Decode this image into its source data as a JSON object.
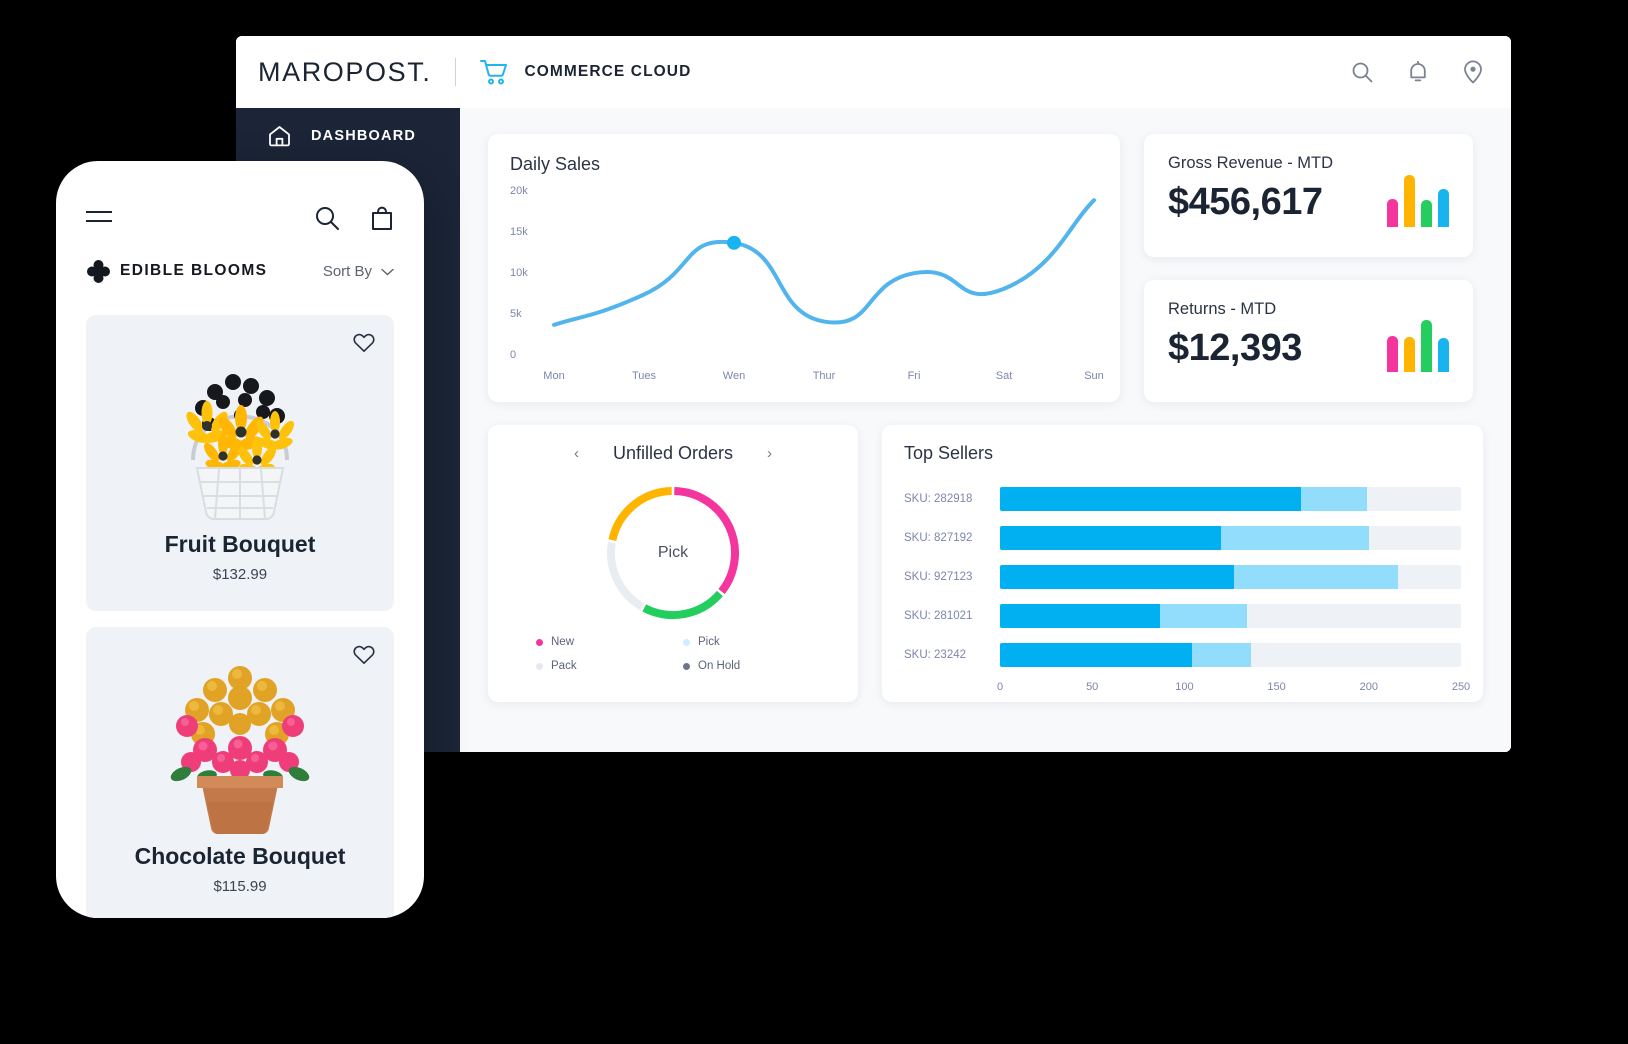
{
  "app": {
    "brand": "MAROPOST",
    "brand_suffix": ".",
    "product_line": "COMMERCE CLOUD",
    "topbar_icons": [
      "search-icon",
      "bell-icon",
      "location-pin-icon"
    ]
  },
  "sidebar": {
    "items": [
      {
        "label": "DASHBOARD",
        "icon": "home-icon",
        "active": true
      }
    ]
  },
  "daily_sales": {
    "title": "Daily Sales"
  },
  "kpis": [
    {
      "title": "Gross Revenue - MTD",
      "value": "$456,617",
      "spark": [
        {
          "color": "#f5359e",
          "height": 28
        },
        {
          "color": "#ffb400",
          "height": 52
        },
        {
          "color": "#23cd5e",
          "height": 27
        },
        {
          "color": "#18b4f0",
          "height": 38
        }
      ]
    },
    {
      "title": "Returns - MTD",
      "value": "$12,393",
      "spark": [
        {
          "color": "#f5359e",
          "height": 36
        },
        {
          "color": "#ffb400",
          "height": 35
        },
        {
          "color": "#23cd5e",
          "height": 52
        },
        {
          "color": "#18b4f0",
          "height": 34
        }
      ]
    }
  ],
  "unfilled_orders": {
    "title": "Unfilled Orders",
    "prev_arrow": "‹",
    "next_arrow": "›",
    "center_label": "Pick",
    "legend": [
      {
        "label": "New",
        "color": "#f5359e"
      },
      {
        "label": "Pick",
        "color": "#cfeefd"
      },
      {
        "label": "Pack",
        "color": "#e4e8ef"
      },
      {
        "label": "On Hold",
        "color": "#6d7588"
      }
    ]
  },
  "top_sellers": {
    "title": "Top Sellers"
  },
  "phone": {
    "menu_icon": "hamburger-icon",
    "search_icon": "search-icon",
    "bag_icon": "shopping-bag-icon",
    "brand": "EDIBLE BLOOMS",
    "brand_icon": "flower-logo-icon",
    "sort_label": "Sort By",
    "sort_chevron": "chevron-down-icon",
    "products": [
      {
        "name": "Fruit Bouquet",
        "price": "$132.99",
        "favourite_icon": "heart-icon",
        "art": "fruit-basket"
      },
      {
        "name": "Chocolate Bouquet",
        "price": "$115.99",
        "favourite_icon": "heart-icon",
        "art": "chocolate-pot"
      }
    ]
  },
  "chart_data": [
    {
      "type": "line",
      "title": "Daily Sales",
      "xlabel": "",
      "ylabel": "",
      "categories": [
        "Mon",
        "Tues",
        "Wen",
        "Thur",
        "Fri",
        "Sat",
        "Sun"
      ],
      "values": [
        3800,
        7500,
        13800,
        4200,
        10100,
        8200,
        19000
      ],
      "ylim": [
        0,
        20000
      ],
      "yticks": [
        "0",
        "5k",
        "10k",
        "15k",
        "20k"
      ],
      "ytick_values": [
        0,
        5000,
        10000,
        15000,
        20000
      ],
      "series": [
        {
          "name": "Daily Sales",
          "color": "#52b4ec",
          "values": [
            3800,
            7500,
            13800,
            4200,
            10100,
            8200,
            19000
          ]
        }
      ],
      "highlight_point": {
        "category": "Wen",
        "value": 13800,
        "color": "#18b4f0"
      },
      "grid": false,
      "legend": "none"
    },
    {
      "type": "pie",
      "title": "Unfilled Orders",
      "center_label": "Pick",
      "labels": [
        "New",
        "On Hold",
        "Pack",
        "Pick"
      ],
      "values": [
        36,
        22,
        20,
        22
      ],
      "colors": [
        "#f5359e",
        "#23cd5e",
        "#e8edf2",
        "#ffb400"
      ],
      "legend": "bottom",
      "donut": true
    },
    {
      "type": "bar",
      "title": "Top Sellers",
      "orientation": "horizontal",
      "categories": [
        "SKU: 282918",
        "SKU: 827192",
        "SKU: 927123",
        "SKU: 281021",
        "SKU: 23242"
      ],
      "series": [
        {
          "name": "Primary",
          "color": "#00b0f0",
          "values": [
            163,
            120,
            127,
            87,
            104
          ]
        },
        {
          "name": "Secondary",
          "color": "#91ddfb",
          "values": [
            36,
            80,
            89,
            47,
            32
          ]
        }
      ],
      "stacked": true,
      "xlim": [
        0,
        250
      ],
      "xticks": [
        "0",
        "50",
        "100",
        "150",
        "200",
        "250"
      ],
      "xtick_values": [
        0,
        50,
        100,
        150,
        200,
        250
      ],
      "grid": false
    }
  ]
}
